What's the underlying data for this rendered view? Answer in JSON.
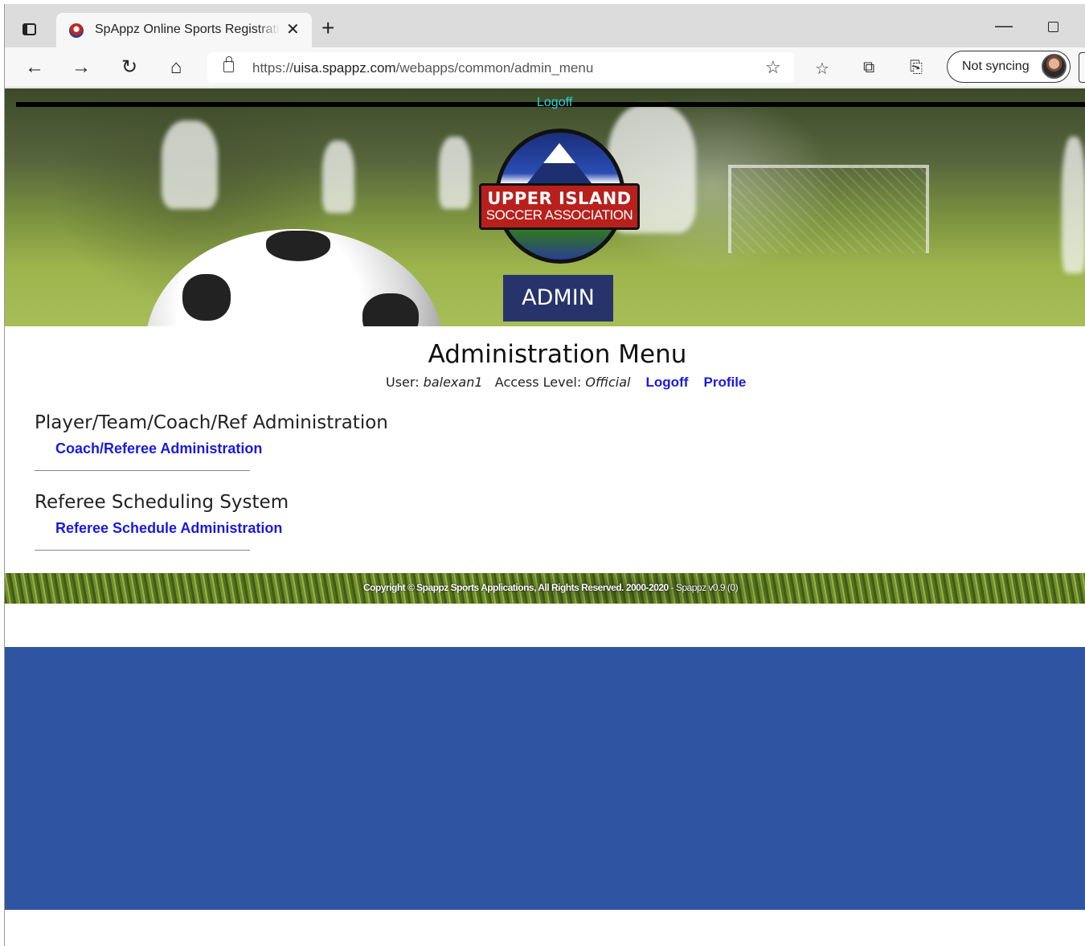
{
  "browser": {
    "tab_title": "SpAppz Online Sports Registration",
    "tab_close": "✕",
    "new_tab": "+",
    "url_prefix": "https://",
    "url_host": "uisa.spappz.com",
    "url_path": "/webapps/common/admin_menu",
    "sync_label": "Not syncing",
    "minimize": "—",
    "nav": {
      "back": "←",
      "forward": "→",
      "refresh": "↻",
      "home": "⌂"
    },
    "icons": {
      "add_favorite": "☆",
      "favorites": "☆",
      "collections": "⧉",
      "share": "⎘"
    }
  },
  "header": {
    "top_logoff": "Logoff",
    "crest_line1": "UPPER ISLAND",
    "crest_line2": "SOCCER ASSOCIATION",
    "badge": "ADMIN"
  },
  "main": {
    "title": "Administration Menu",
    "user_label": "User:",
    "user_name": "balexan1",
    "access_label": "Access Level:",
    "access_value": "Official",
    "logoff_link": "Logoff",
    "profile_link": "Profile",
    "sections": [
      {
        "heading": "Player/Team/Coach/Ref Administration",
        "link": "Coach/Referee Administration"
      },
      {
        "heading": "Referee Scheduling System",
        "link": "Referee Schedule Administration"
      }
    ]
  },
  "footer": {
    "copyright": "Copyright © Spappz Sports Applications, All Rights Reserved. 2000-2020",
    "version": " - Spappz v0.9 (0)"
  },
  "colors": {
    "link": "#1a1adc",
    "top_logoff": "#29d4dc",
    "admin_badge": "#27346b",
    "blue_block": "#2e54a2",
    "crest_red": "#b8201c"
  }
}
